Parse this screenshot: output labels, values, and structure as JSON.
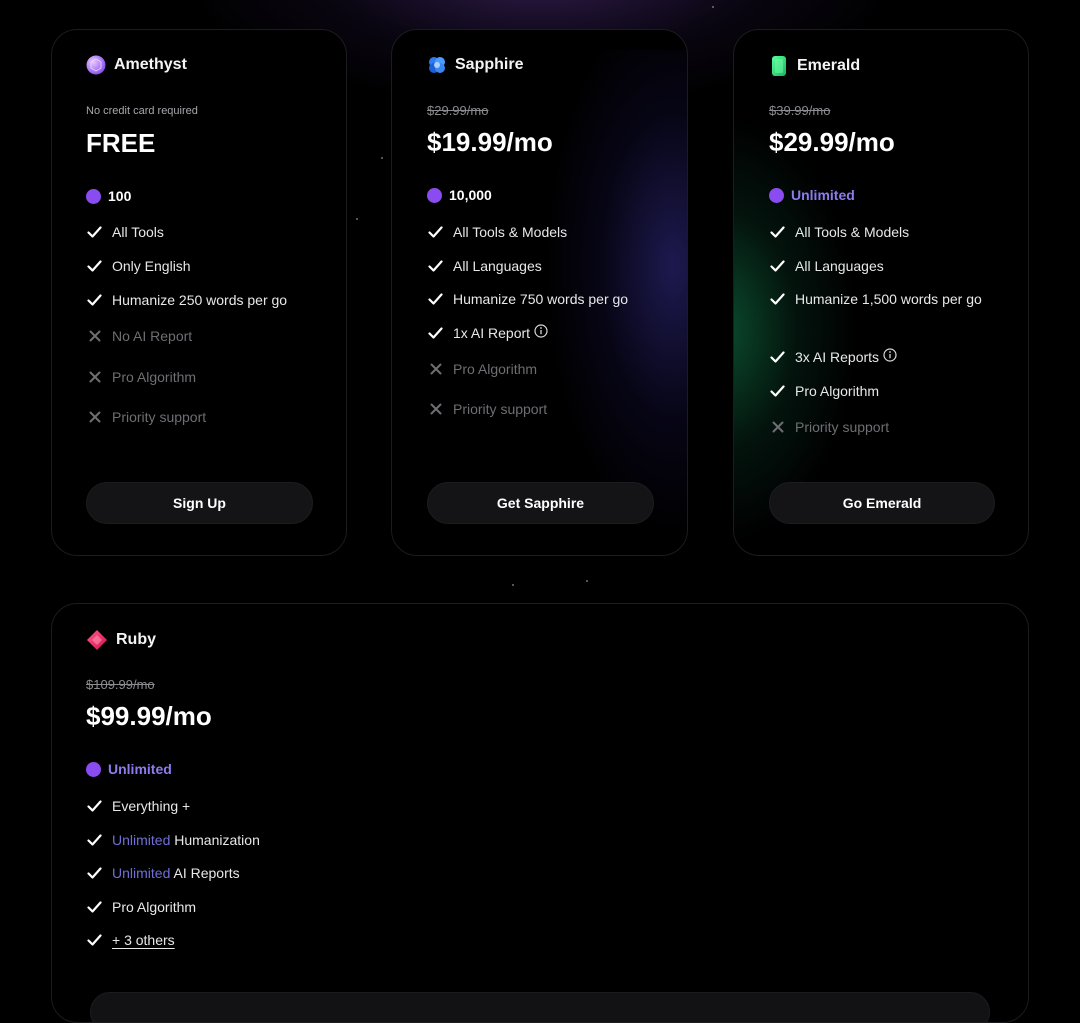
{
  "plans": {
    "amethyst": {
      "name": "Amethyst",
      "note": "No credit card required",
      "price": "FREE",
      "credits": "100",
      "features": [
        {
          "text": "All Tools",
          "included": true
        },
        {
          "text": "Only English",
          "included": true
        },
        {
          "text": "Humanize 250 words per go",
          "included": true
        },
        {
          "text": "No AI Report",
          "included": false
        },
        {
          "text": "Pro Algorithm",
          "included": false
        },
        {
          "text": "Priority support",
          "included": false
        }
      ],
      "cta": "Sign Up"
    },
    "sapphire": {
      "name": "Sapphire",
      "old_price": "$29.99/mo",
      "price": "$19.99/mo",
      "credits": "10,000",
      "features": [
        {
          "text": "All Tools & Models",
          "included": true
        },
        {
          "text": "All Languages",
          "included": true
        },
        {
          "text": "Humanize 750 words per go",
          "included": true
        },
        {
          "text": "1x AI Report",
          "included": true,
          "info": true
        },
        {
          "text": "Pro Algorithm",
          "included": false
        },
        {
          "text": "Priority support",
          "included": false
        }
      ],
      "cta": "Get Sapphire"
    },
    "emerald": {
      "name": "Emerald",
      "old_price": "$39.99/mo",
      "price": "$29.99/mo",
      "credits": "Unlimited",
      "features": [
        {
          "text": "All Tools & Models",
          "included": true
        },
        {
          "text": "All Languages",
          "included": true
        },
        {
          "text": "Humanize 1,500 words per go",
          "included": true
        },
        {
          "text": "3x AI Reports",
          "included": true,
          "info": true
        },
        {
          "text": "Pro Algorithm",
          "included": true
        },
        {
          "text": "Priority support",
          "included": false
        }
      ],
      "cta": "Go Emerald"
    },
    "ruby": {
      "name": "Ruby",
      "old_price": "$109.99/mo",
      "price": "$99.99/mo",
      "credits": "Unlimited",
      "features": {
        "everything": "Everything +",
        "humanization_accent": "Unlimited",
        "humanization_rest": " Humanization",
        "reports_accent": "Unlimited",
        "reports_rest": " AI Reports",
        "pro": "Pro Algorithm",
        "others": "+ 3 others"
      }
    }
  },
  "colors": {
    "background": "#000000",
    "credit_dot": "#8a4bf0",
    "accent_text": "#8c7cf0",
    "check": "#ffffff",
    "cross": "#6e6e73"
  },
  "icons": {
    "amethyst": "amethyst-gem-icon",
    "sapphire": "sapphire-gem-icon",
    "emerald": "emerald-gem-icon",
    "ruby": "ruby-gem-icon",
    "included": "check-icon",
    "excluded": "x-icon",
    "info": "info-icon"
  }
}
